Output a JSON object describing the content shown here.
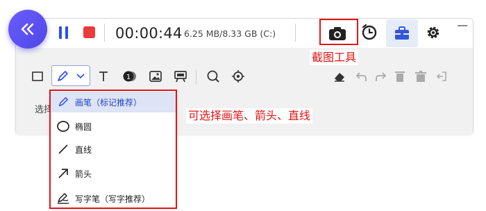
{
  "topbar": {
    "collapse_icon": "double-chevron-left-icon",
    "pause_icon": "pause-icon",
    "stop_icon": "stop-icon",
    "timer": "00:00:44",
    "storage": "6.25 MB/8.33 GB (C:)",
    "screenshot_icon": "camera-icon",
    "schedule_icon": "alarm-clock-icon",
    "toolbox_icon": "toolbox-icon",
    "settings_icon": "gear-icon",
    "minimize_icon": "minimize-icon"
  },
  "annotations": {
    "screenshot_tool": "截图工具",
    "pen_hint": "可选择画笔、箭头、直线"
  },
  "toolbar": {
    "tools": [
      "rectangle-icon",
      "pen-icon",
      "chevron-down-icon",
      "text-icon",
      "numbered-marker-icon",
      "image-icon",
      "whiteboard-icon",
      "zoom-icon",
      "spotlight-icon",
      "eraser-icon",
      "undo-icon",
      "redo-icon",
      "delete-icon",
      "clear-all-icon",
      "exit-icon"
    ],
    "numbered_marker": "1",
    "hint_label": "选择"
  },
  "dropdown": {
    "items": [
      {
        "label": "画笔（标记推荐）",
        "icon": "pen-icon",
        "selected": true
      },
      {
        "label": "椭圆",
        "icon": "ellipse-icon",
        "selected": false
      },
      {
        "label": "直线",
        "icon": "line-icon",
        "selected": false
      },
      {
        "label": "箭头",
        "icon": "arrow-icon",
        "selected": false
      },
      {
        "label": "写字笔（写字推荐）",
        "icon": "writing-pen-icon",
        "selected": false
      }
    ]
  },
  "colors": {
    "accent": "#2a4bff",
    "collapse": "#5a4ff0",
    "stop": "#ea3b3b",
    "annotation": "#e11414",
    "selected_bg": "#dce4f6",
    "toolbox": "#3557d6"
  }
}
